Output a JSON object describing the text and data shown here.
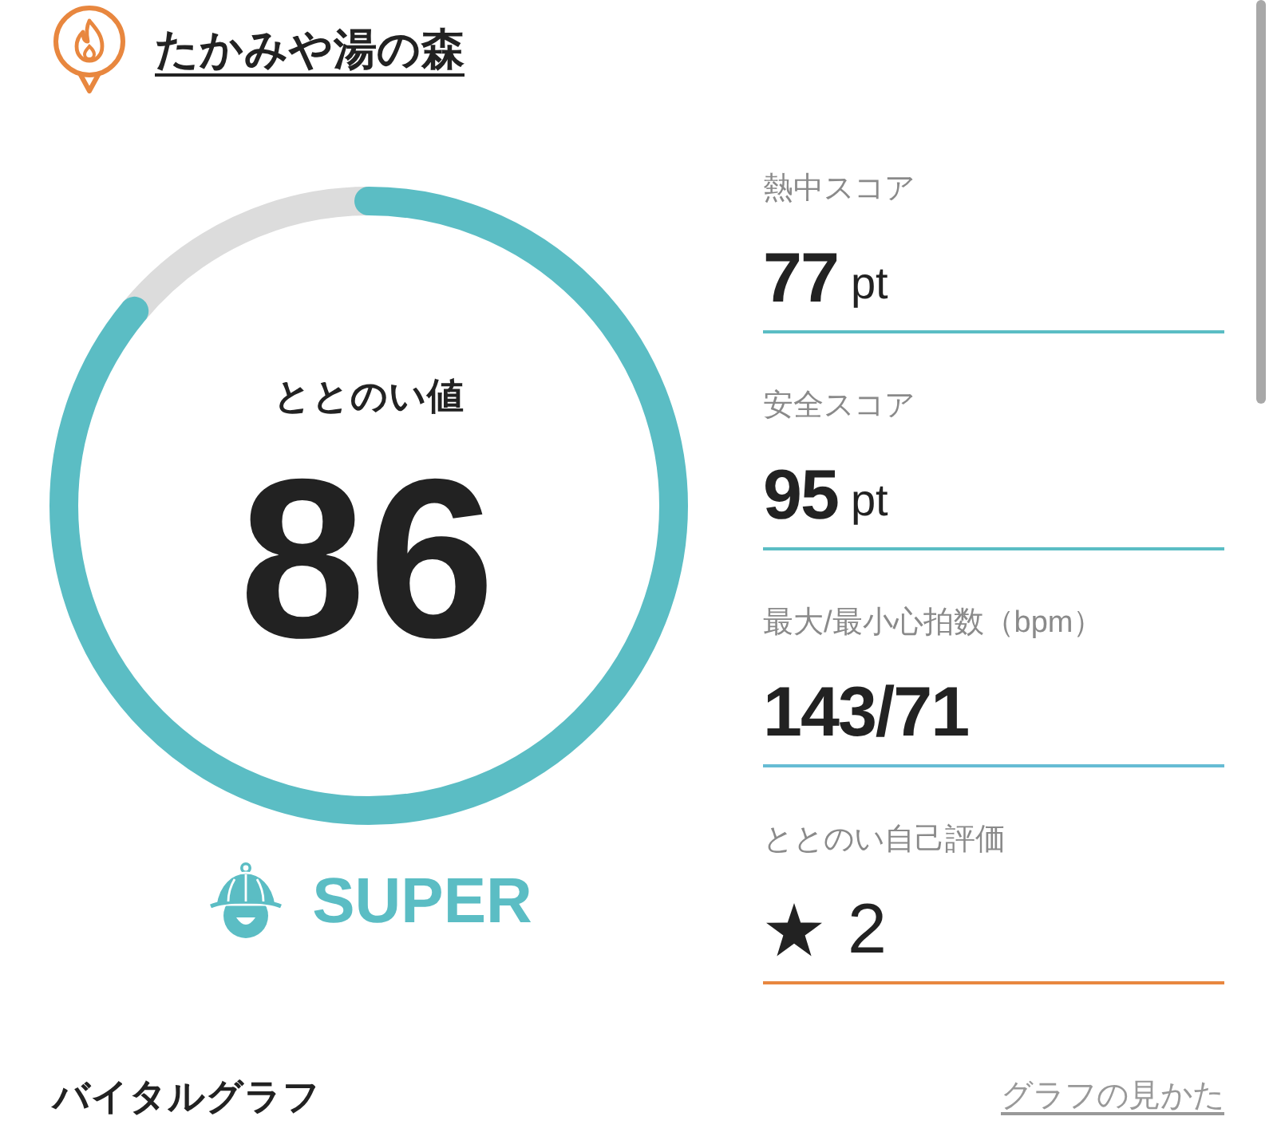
{
  "header": {
    "venue_name": "たかみや湯の森"
  },
  "gauge": {
    "label": "ととのい値",
    "value": "86",
    "level": 0.86
  },
  "rank": {
    "label": "SUPER"
  },
  "metrics": [
    {
      "kind": "number",
      "label": "熱中スコア",
      "value": "77",
      "unit": "pt",
      "color": "#5bbdc4"
    },
    {
      "kind": "number",
      "label": "安全スコア",
      "value": "95",
      "unit": "pt",
      "color": "#5bbdc4"
    },
    {
      "kind": "number",
      "label": "最大/最小心拍数（bpm）",
      "value": "143/71",
      "color": "#66bcd4"
    },
    {
      "kind": "rating",
      "label": "ととのい自己評価",
      "value": "2",
      "color": "#e8873f"
    }
  ],
  "section": {
    "title": "バイタルグラフ",
    "link": "グラフの見かた"
  }
}
